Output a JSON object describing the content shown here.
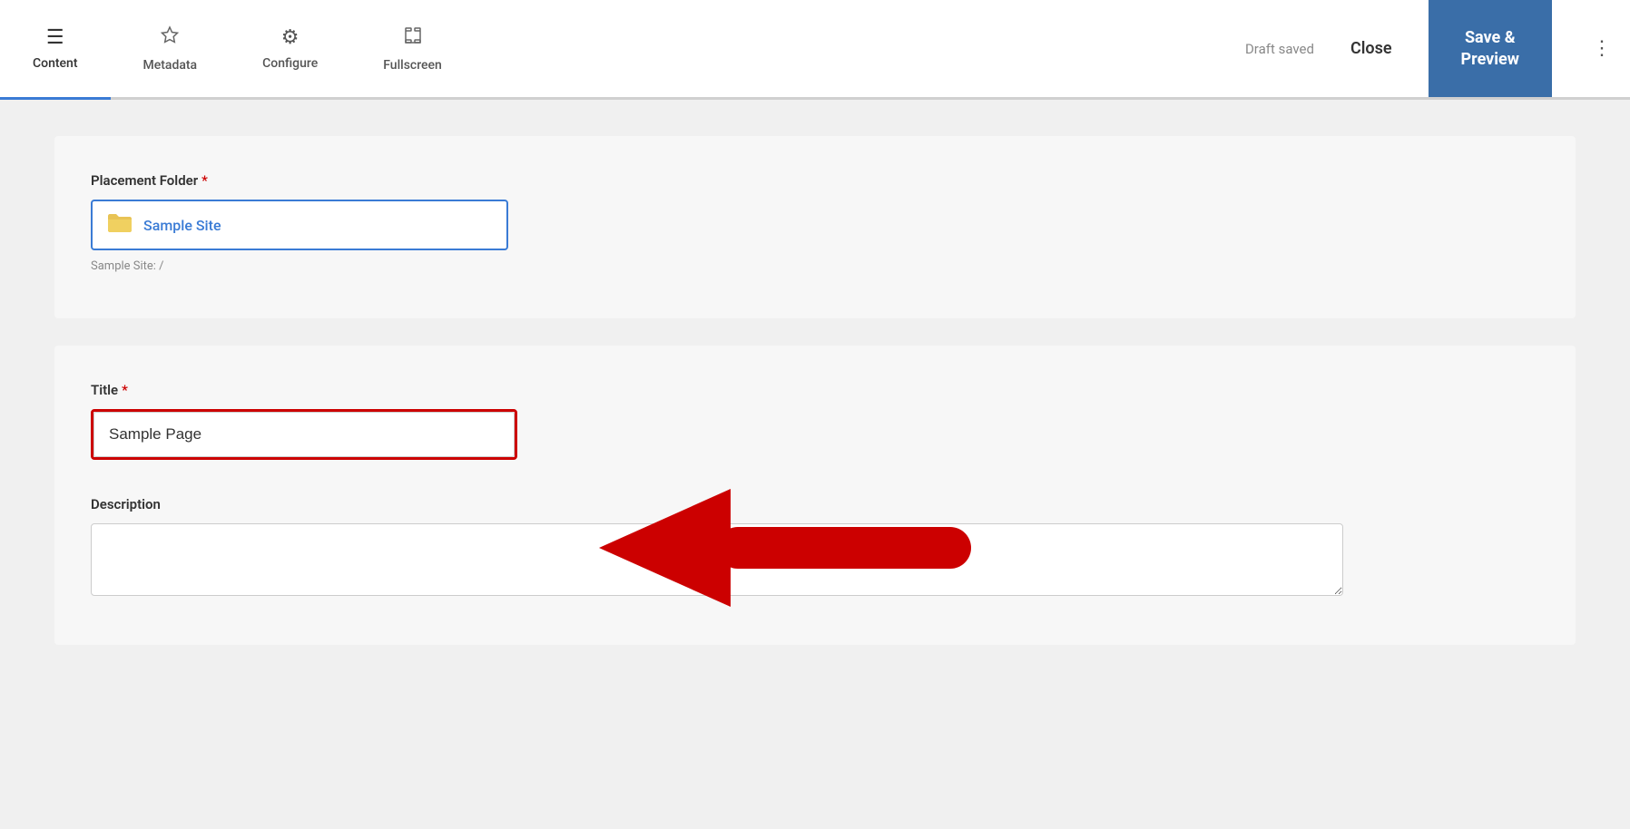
{
  "toolbar": {
    "tabs": [
      {
        "id": "content",
        "label": "Content",
        "icon": "☰",
        "active": true
      },
      {
        "id": "metadata",
        "label": "Metadata",
        "icon": "◇",
        "active": false
      },
      {
        "id": "configure",
        "label": "Configure",
        "icon": "⚙",
        "active": false
      },
      {
        "id": "fullscreen",
        "label": "Fullscreen",
        "icon": "⛶",
        "active": false
      }
    ],
    "draft_saved_label": "Draft saved",
    "close_label": "Close",
    "save_preview_label": "Save &\nPreview",
    "more_icon": "⋮"
  },
  "placement": {
    "label": "Placement Folder",
    "required": "*",
    "folder_name": "Sample Site",
    "folder_path": "Sample Site: /"
  },
  "title_field": {
    "label": "Title",
    "required": "*",
    "value": "Sample Page"
  },
  "description_field": {
    "label": "Description",
    "placeholder": ""
  },
  "colors": {
    "active_tab_border": "#3a7bd5",
    "save_btn_bg": "#3a6ea8",
    "arrow_red": "#cc0000",
    "folder_border": "#3a7bd5"
  }
}
